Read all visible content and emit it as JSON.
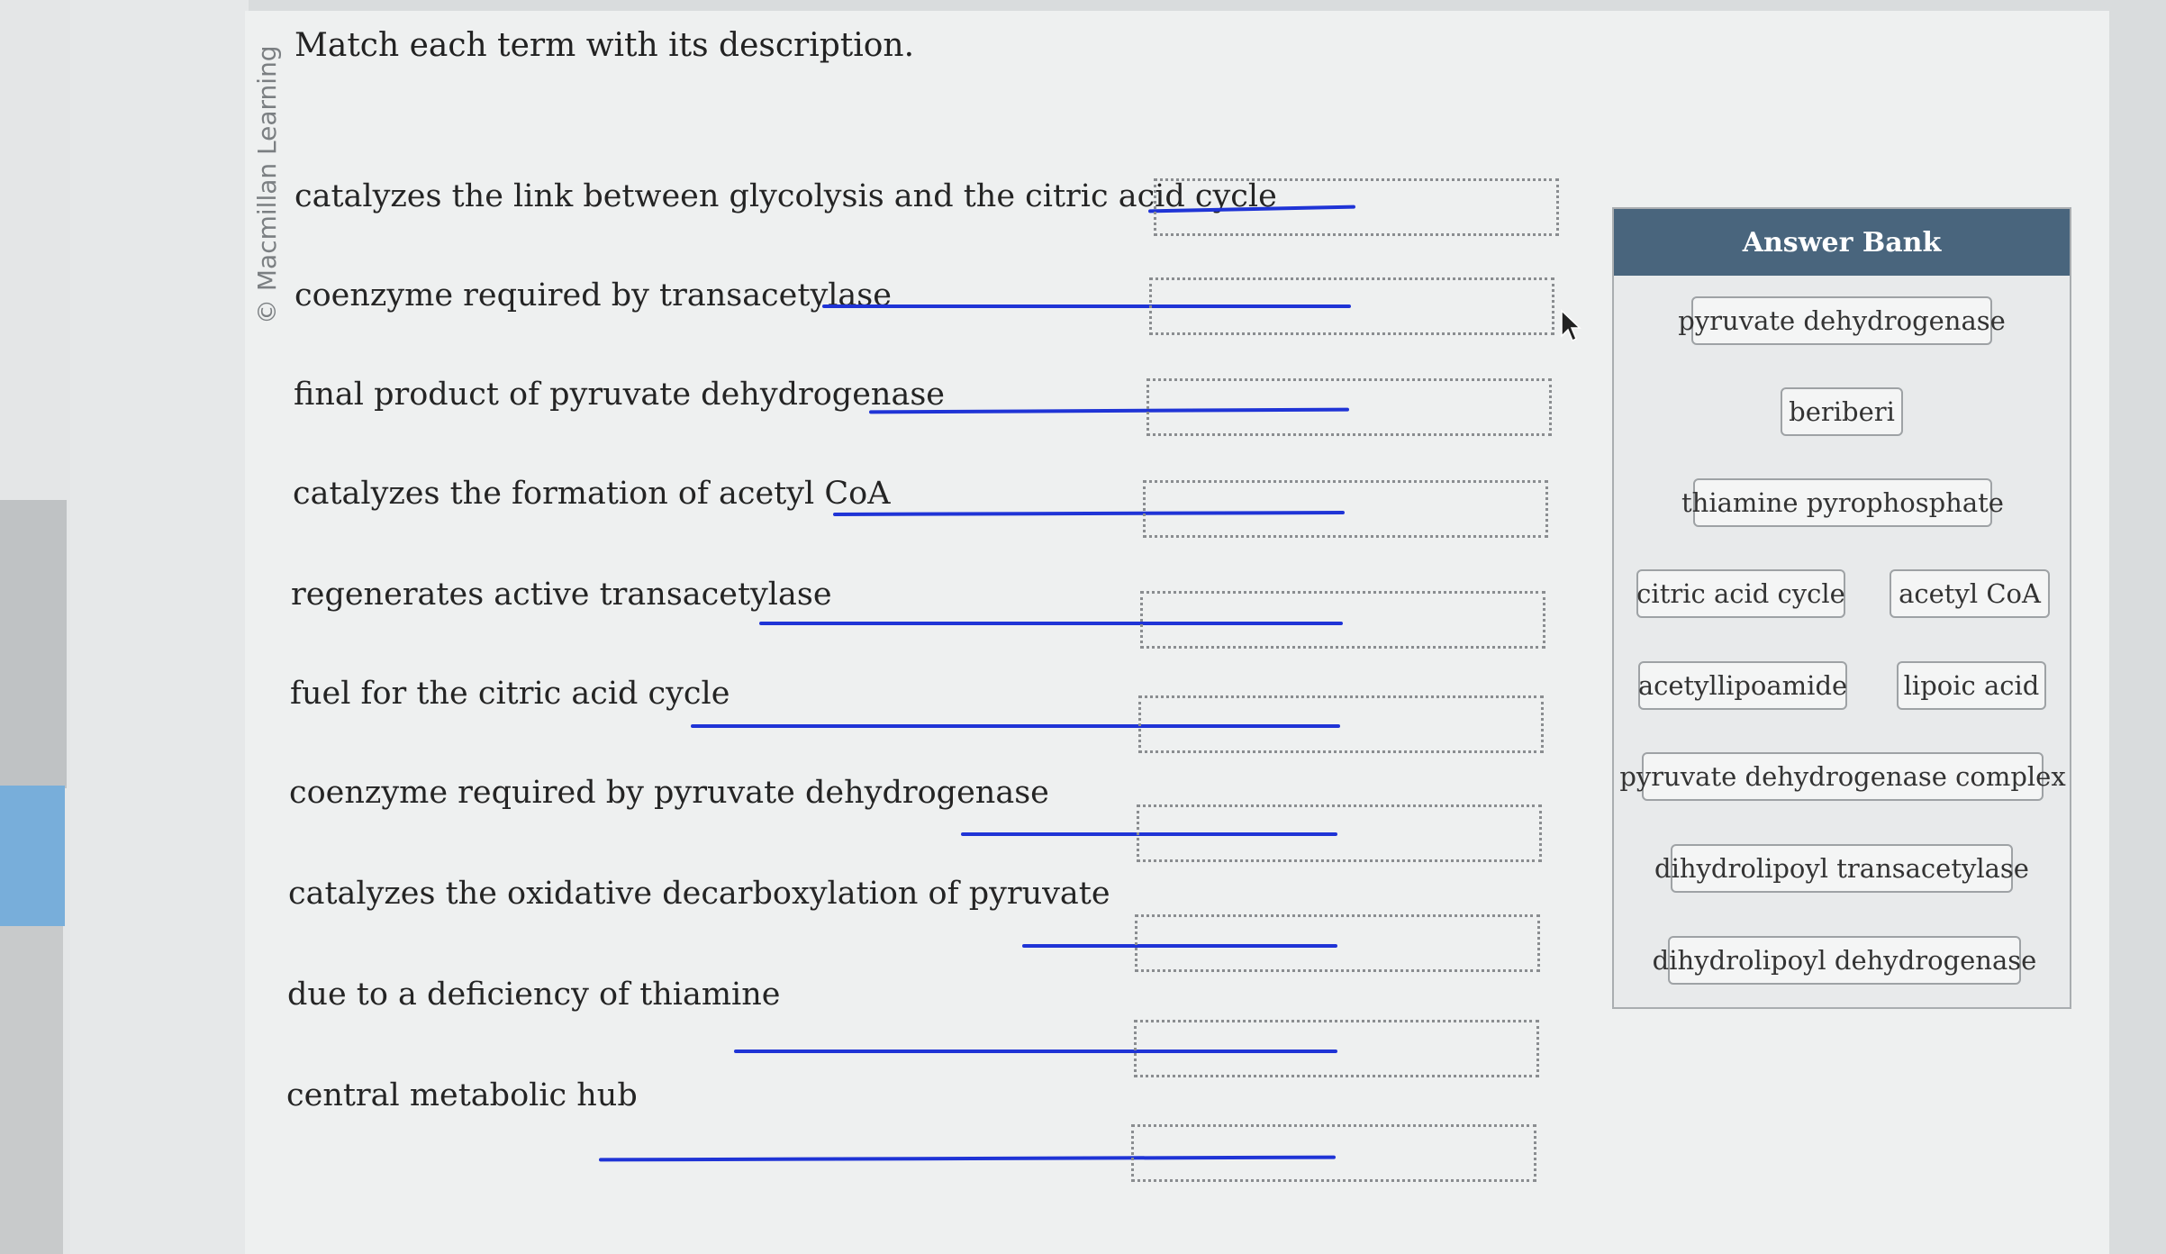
{
  "copyright": "© Macmillan Learning",
  "question": {
    "title": "Match each term with its description."
  },
  "descriptions": [
    "catalyzes the link between glycolysis and the citric acid cycle",
    "coenzyme required by transacetylase",
    "final product of pyruvate dehydrogenase",
    "catalyzes the formation of acetyl CoA",
    "regenerates active transacetylase",
    "fuel for the citric acid cycle",
    "coenzyme required by pyruvate dehydrogenase",
    "catalyzes the oxidative decarboxylation of pyruvate",
    "due to a deficiency of thiamine",
    "central metabolic hub"
  ],
  "answer_bank": {
    "title": "Answer Bank",
    "items": [
      "pyruvate dehydrogenase",
      "beriberi",
      "thiamine pyrophosphate",
      "citric acid cycle",
      "acetyl CoA",
      "acetyllipoamide",
      "lipoic acid",
      "pyruvate dehydrogenase complex",
      "dihydrolipoyl transacetylase",
      "dihydrolipoyl dehydrogenase"
    ]
  },
  "colors": {
    "header_bg": "#49657d",
    "handwritten_line": "#1f34d6"
  },
  "icons": [
    "mouse-cursor-icon"
  ]
}
